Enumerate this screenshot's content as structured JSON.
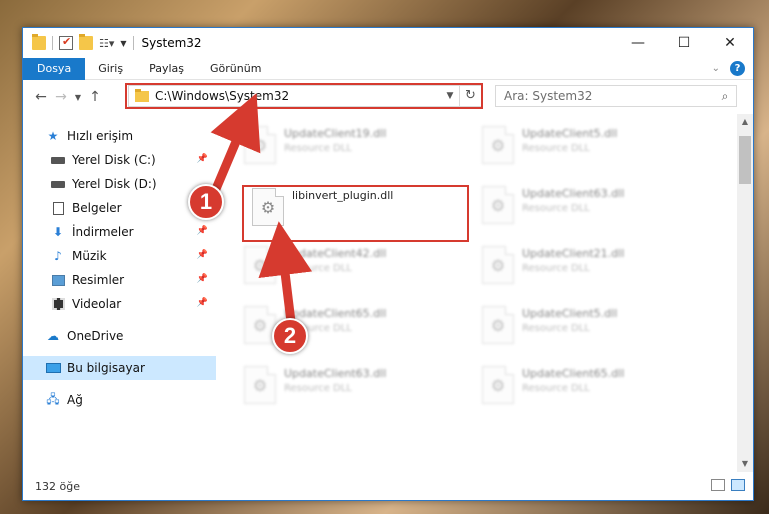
{
  "window": {
    "title": "System32",
    "controls": {
      "minimize": "—",
      "maximize": "☐",
      "close": "✕"
    }
  },
  "ribbon": {
    "tabs": [
      {
        "label": "Dosya",
        "active": true
      },
      {
        "label": "Giriş"
      },
      {
        "label": "Paylaş"
      },
      {
        "label": "Görünüm"
      }
    ],
    "help": "?"
  },
  "address": {
    "path": "C:\\Windows\\System32",
    "search_placeholder": "Ara: System32"
  },
  "nav": {
    "items": [
      {
        "label": "Hızlı erişim",
        "icon": "star-icon"
      },
      {
        "label": "Yerel Disk (C:)",
        "icon": "drive-icon",
        "pinned": true
      },
      {
        "label": "Yerel Disk (D:)",
        "icon": "drive-icon"
      },
      {
        "label": "Belgeler",
        "icon": "documents-icon"
      },
      {
        "label": "İndirmeler",
        "icon": "downloads-icon",
        "pinned": true
      },
      {
        "label": "Müzik",
        "icon": "music-icon",
        "pinned": true
      },
      {
        "label": "Resimler",
        "icon": "pictures-icon",
        "pinned": true
      },
      {
        "label": "Videolar",
        "icon": "videos-icon",
        "pinned": true
      },
      {
        "label": "OneDrive",
        "icon": "cloud-icon"
      },
      {
        "label": "Bu bilgisayar",
        "icon": "computer-icon",
        "selected": true
      },
      {
        "label": "Ağ",
        "icon": "network-icon"
      }
    ]
  },
  "files": [
    {
      "name": "UpdateClient19.dll",
      "type": "Resource DLL",
      "blurred": true
    },
    {
      "name": "UpdateClient5.dll",
      "type": "Resource DLL",
      "blurred": true
    },
    {
      "name": "libinvert_plugin.dll",
      "type": "",
      "highlighted": true
    },
    {
      "name": "UpdateClient63.dll",
      "type": "Resource DLL",
      "blurred": true
    },
    {
      "name": "UpdateClient42.dll",
      "type": "Resource DLL",
      "blurred": true
    },
    {
      "name": "UpdateClient21.dll",
      "type": "Resource DLL",
      "blurred": true
    },
    {
      "name": "UpdateClient65.dll",
      "type": "Resource DLL",
      "blurred": true
    },
    {
      "name": "UpdateClient5.dll",
      "type": "Resource DLL",
      "blurred": true
    },
    {
      "name": "UpdateClient63.dll",
      "type": "Resource DLL",
      "blurred": true
    },
    {
      "name": "UpdateClient65.dll",
      "type": "Resource DLL",
      "blurred": true
    }
  ],
  "status": {
    "count": "132 öğe"
  },
  "annotations": {
    "step1": "1",
    "step2": "2",
    "color": "#d63a2f"
  }
}
